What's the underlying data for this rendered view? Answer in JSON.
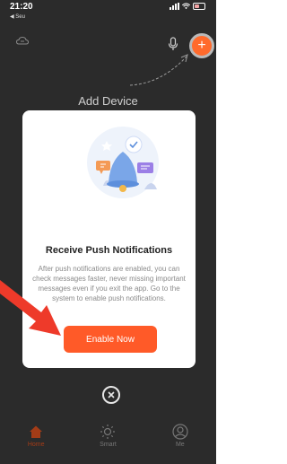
{
  "status_bar": {
    "time": "21:20",
    "back_label": "◀ Seu"
  },
  "header": {
    "title": "Add Device"
  },
  "modal": {
    "title": "Receive Push Notifications",
    "body": "After push notifications are enabled, you can check messages faster, never missing important messages even if you exit the app. Go to the system to enable push notifications.",
    "button_label": "Enable Now"
  },
  "tabs": [
    {
      "label": "Home",
      "icon": "home-icon"
    },
    {
      "label": "Smart",
      "icon": "sun-icon"
    },
    {
      "label": "Me",
      "icon": "person-icon"
    }
  ],
  "colors": {
    "accent": "#ff5a28",
    "overlay": "#2b2b2b",
    "annotation_arrow": "#ee3a2a"
  }
}
